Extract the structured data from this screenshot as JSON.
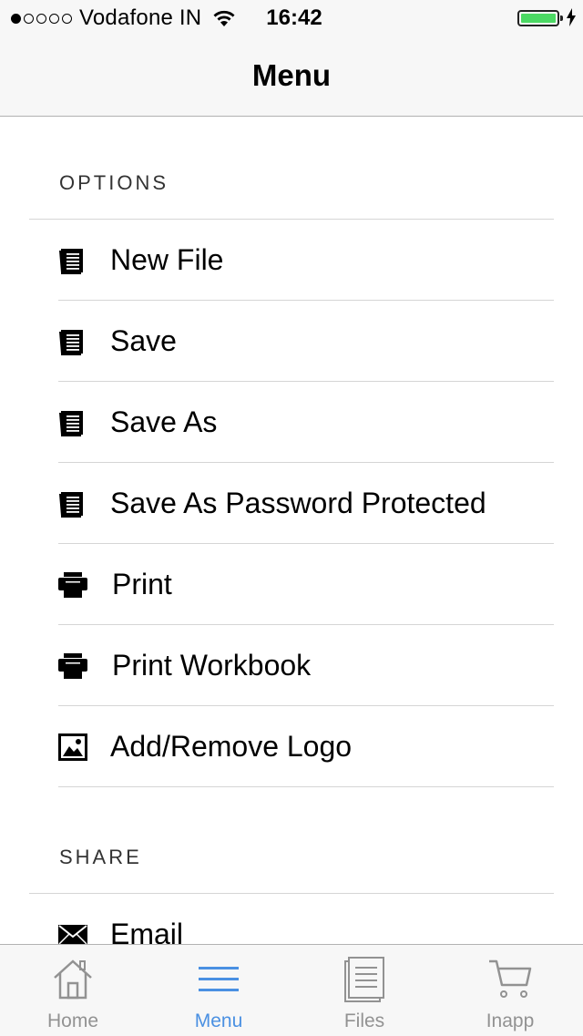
{
  "status_bar": {
    "carrier": "Vodafone IN",
    "time": "16:42"
  },
  "nav": {
    "title": "Menu"
  },
  "sections": {
    "options": {
      "header": "OPTIONS",
      "items": [
        {
          "label": "New File",
          "icon": "document-icon"
        },
        {
          "label": "Save",
          "icon": "document-icon"
        },
        {
          "label": "Save As",
          "icon": "document-icon"
        },
        {
          "label": "Save As Password Protected",
          "icon": "document-icon"
        },
        {
          "label": "Print",
          "icon": "printer-icon"
        },
        {
          "label": "Print Workbook",
          "icon": "printer-icon"
        },
        {
          "label": "Add/Remove Logo",
          "icon": "image-icon"
        }
      ]
    },
    "share": {
      "header": "SHARE",
      "items": [
        {
          "label": "Email",
          "icon": "envelope-icon"
        }
      ]
    }
  },
  "tabbar": {
    "tabs": [
      {
        "label": "Home",
        "icon": "home-icon",
        "active": false
      },
      {
        "label": "Menu",
        "icon": "menu-icon",
        "active": true
      },
      {
        "label": "Files",
        "icon": "files-icon",
        "active": false
      },
      {
        "label": "Inapp",
        "icon": "cart-icon",
        "active": false
      }
    ]
  },
  "colors": {
    "accent": "#4a90e2",
    "inactive_tab": "#929292",
    "battery": "#4cd964",
    "separator": "#d5d5d5"
  }
}
